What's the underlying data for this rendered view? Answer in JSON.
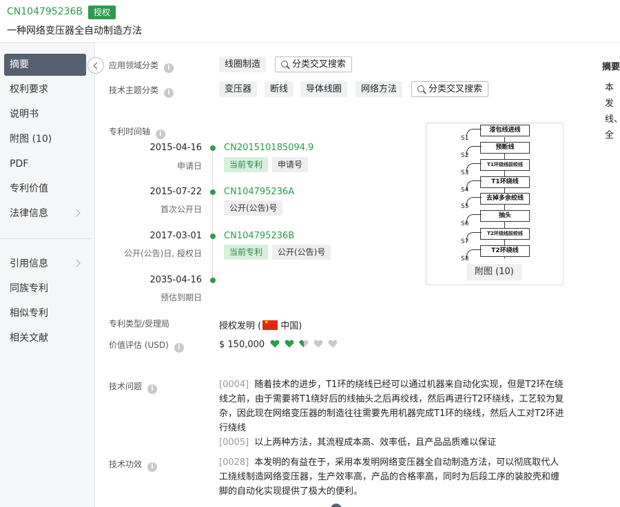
{
  "header": {
    "pub_no": "CN104795236B",
    "status": "授权",
    "title": "一种网络变压器全自动制造方法"
  },
  "sidebar": {
    "items": [
      {
        "label": "摘要",
        "active": true
      },
      {
        "label": "权利要求"
      },
      {
        "label": "说明书"
      },
      {
        "label": "附图 (10)"
      },
      {
        "label": "PDF"
      },
      {
        "label": "专利价值"
      },
      {
        "label": "法律信息",
        "chevron": true
      },
      {
        "label": "引用信息",
        "chevron": true
      },
      {
        "label": "同族专利"
      },
      {
        "label": "相似专利"
      },
      {
        "label": "相关文献"
      }
    ]
  },
  "classification": {
    "app_label": "应用领域分类",
    "app_tags": [
      "线圈制造"
    ],
    "tech_label": "技术主题分类",
    "tech_tags": [
      "变压器",
      "断线",
      "导体线圈",
      "网络方法"
    ],
    "cross_search": "分类交叉搜索"
  },
  "timeline": {
    "label": "专利时间轴",
    "events": [
      {
        "date": "2015-04-16",
        "sub": "申请日",
        "number": "CN201510185094.9",
        "chips": [
          "当前专利",
          "申请号"
        ]
      },
      {
        "date": "2015-07-22",
        "sub": "首次公开日",
        "number": "CN104795236A",
        "chips": [
          "公开(公告)号"
        ]
      },
      {
        "date": "2017-03-01",
        "sub": "公开(公告)日, 授权日",
        "number": "CN104795236B",
        "chips": [
          "当前专利",
          "公开(公告)号"
        ]
      },
      {
        "date": "2035-04-16",
        "sub": "预估到期日"
      }
    ]
  },
  "figure": {
    "caption": "附图 (10)",
    "steps": [
      {
        "s": "S1",
        "box": "漆包线进线"
      },
      {
        "s": "S2",
        "box": "预断线"
      },
      {
        "s": "S3",
        "box": "T1环绕线前绞线"
      },
      {
        "s": "S4",
        "box": "T1环绕线"
      },
      {
        "s": "S5",
        "box": "去掉多余绞线"
      },
      {
        "s": "S6",
        "box": "抽头"
      },
      {
        "s": "S7",
        "box": "T2环绕线前绞线"
      },
      {
        "s": "S8",
        "box": "T2环绕线"
      }
    ]
  },
  "patent_type": {
    "label": "专利类型/受理局",
    "value_prefix": "授权发明 (",
    "country": "中国",
    "value_suffix": ")"
  },
  "valuation": {
    "label": "价值评估 (USD)",
    "amount": "$ 150,000",
    "rating": 2.5,
    "max": 5,
    "colors": {
      "filled": "#2e9b4c",
      "empty": "#c8c8c8"
    }
  },
  "tech_problem": {
    "label": "技术问题",
    "paras": [
      {
        "no": "[0004]",
        "text": "随着技术的进步，T1环的绕线已经可以通过机器来自动化实现，但是T2环在绕线之前，由于需要将T1绕好后的线抽头之后再绞线，然后再进行T2环绕线，工艺较为复杂，因此现在网络变压器的制造往往需要先用机器完成T1环的绕线，然后人工对T2环进行绕线"
      },
      {
        "no": "[0005]",
        "text": "以上两种方法，其流程成本高、效率低，且产品品质难以保证"
      }
    ]
  },
  "tech_effect": {
    "label": "技术功效",
    "paras": [
      {
        "no": "[0028]",
        "text": "本发明的有益在于，采用本发明网络变压器全自动制造方法，可以彻底取代人工绕线制造网络变压器，生产效率高，产品的合格率高，同时为后段工序的装胶壳和缠脚的自动化实现提供了极大的便利。"
      }
    ]
  },
  "right_panel": {
    "title": "摘要",
    "text": "本发线、全自装胶"
  }
}
